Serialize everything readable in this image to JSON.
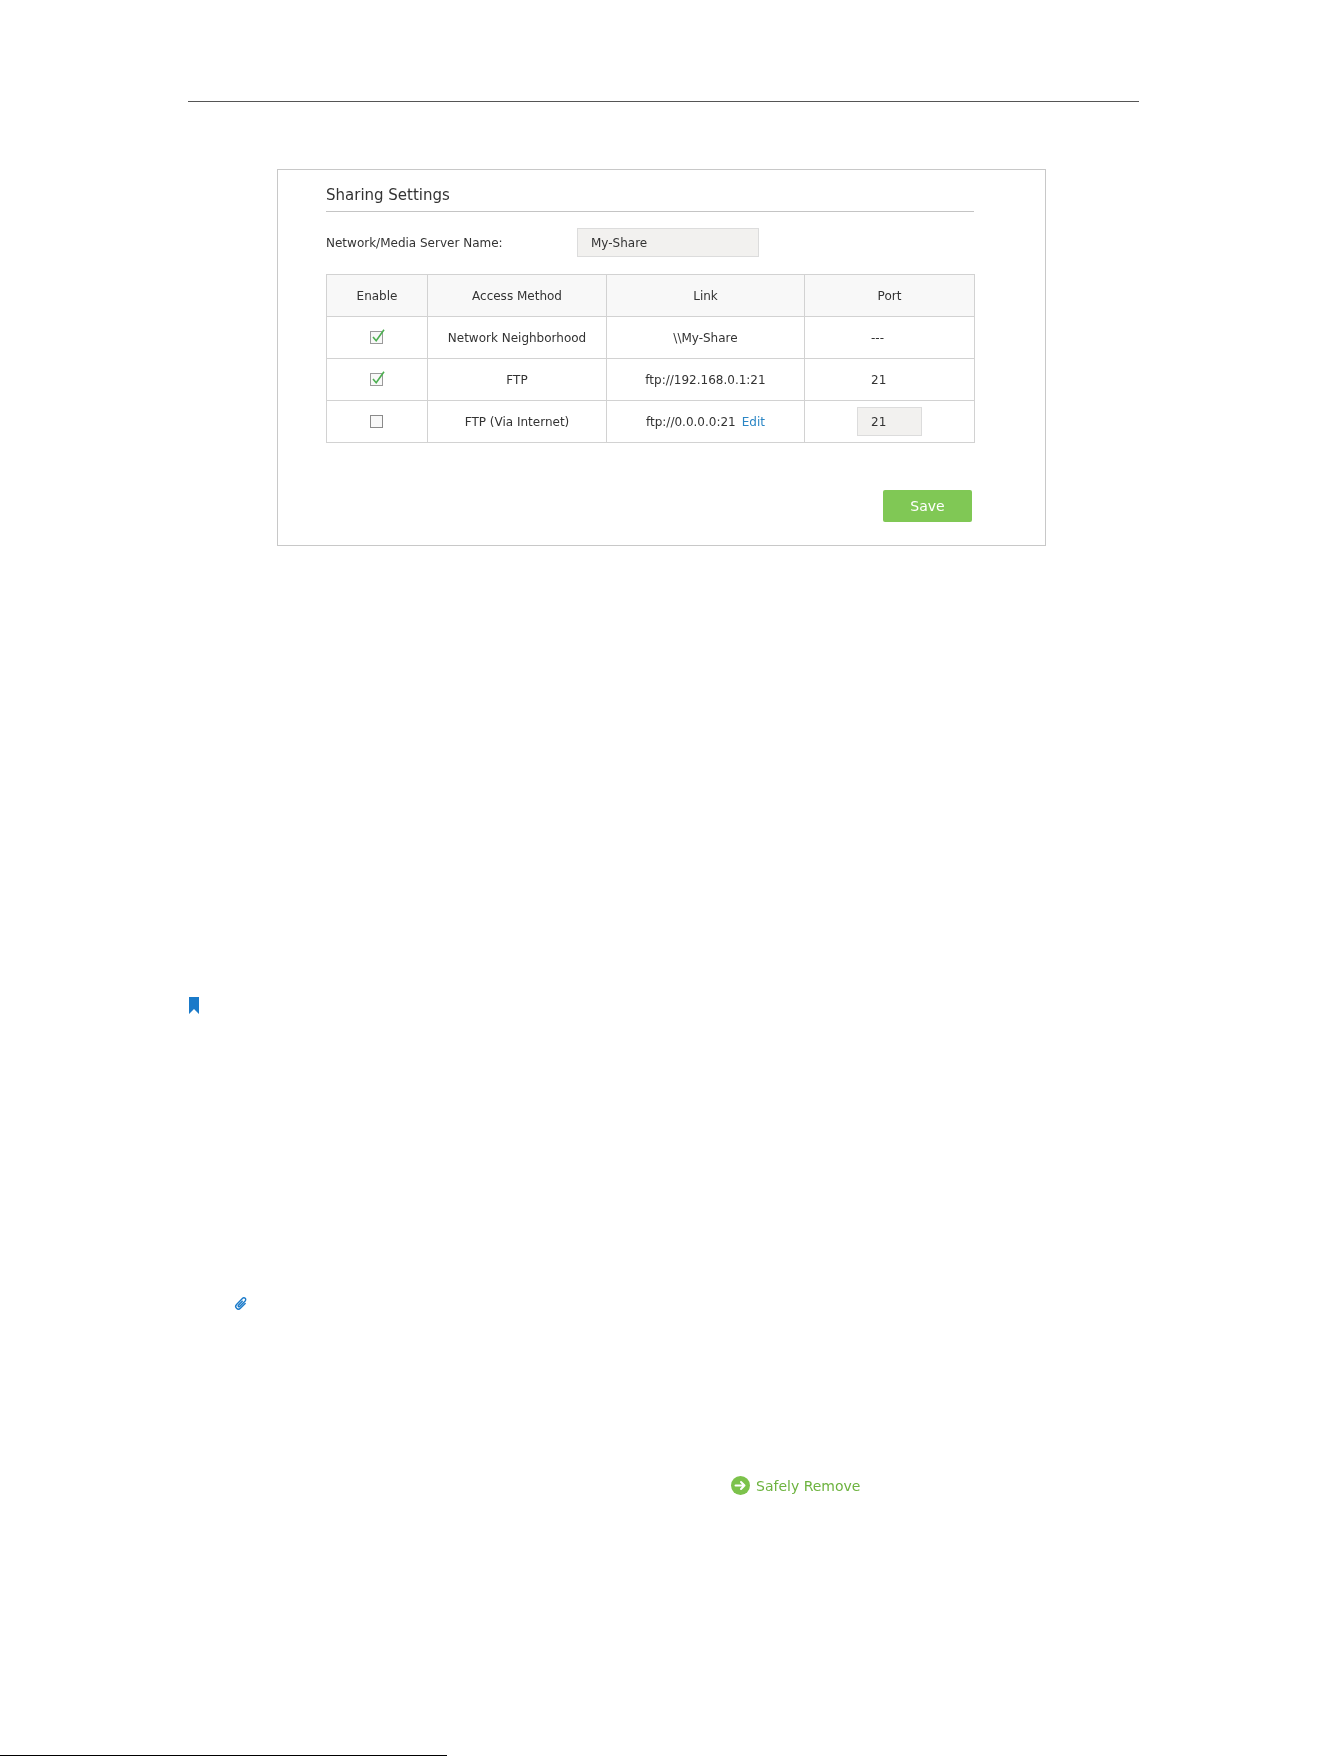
{
  "sharing_settings": {
    "title": "Sharing Settings",
    "server_name": {
      "label": "Network/Media Server Name:",
      "value": "My-Share"
    },
    "table": {
      "columns": [
        "Enable",
        "Access Method",
        "Link",
        "Port"
      ],
      "rows": [
        {
          "checked": true,
          "access_method": "Network Neighborhood",
          "link": "\\\\My-Share",
          "port": {
            "kind": "text",
            "value": "---"
          }
        },
        {
          "checked": true,
          "access_method": "FTP",
          "link": "ftp://192.168.0.1:21",
          "port": {
            "kind": "text",
            "value": "21"
          }
        },
        {
          "checked": false,
          "access_method": "FTP (Via Internet)",
          "link": "ftp://0.0.0.0:21",
          "edit_link": "Edit",
          "port": {
            "kind": "input",
            "value": "21"
          }
        }
      ]
    },
    "save_button": "Save"
  },
  "safely_remove_link": {
    "label": "Safely Remove"
  }
}
